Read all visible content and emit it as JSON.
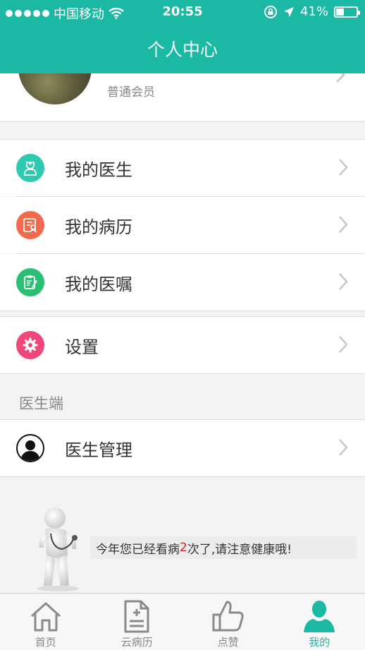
{
  "status_bar": {
    "carrier": "中国移动",
    "time": "20:55",
    "battery": "41%",
    "battery_level": 0.41
  },
  "header": {
    "title": "个人中心"
  },
  "profile": {
    "member_level": "普通会员"
  },
  "menu": [
    {
      "label": "我的医生",
      "icon": "doctor-icon",
      "color": "#2fc9b0"
    },
    {
      "label": "我的病历",
      "icon": "medical-record-icon",
      "color": "#f26a4b"
    },
    {
      "label": "我的医嘱",
      "icon": "prescription-icon",
      "color": "#2bbf73"
    }
  ],
  "settings": {
    "label": "设置",
    "icon": "gear-icon",
    "color": "#f0477b"
  },
  "doctor_section": {
    "title": "医生端",
    "item_label": "医生管理",
    "icon": "doctor-avatar-icon"
  },
  "tip": {
    "prefix": "今年您已经看病",
    "count": "2",
    "suffix": "次了,请注意健康哦!"
  },
  "tabs": [
    {
      "label": "首页",
      "icon": "home-icon"
    },
    {
      "label": "云病历",
      "icon": "cloud-record-icon"
    },
    {
      "label": "点赞",
      "icon": "thumbs-up-icon"
    },
    {
      "label": "我的",
      "icon": "user-icon",
      "active": true
    }
  ],
  "colors": {
    "accent": "#1bb9a4",
    "highlight": "#e02020"
  }
}
